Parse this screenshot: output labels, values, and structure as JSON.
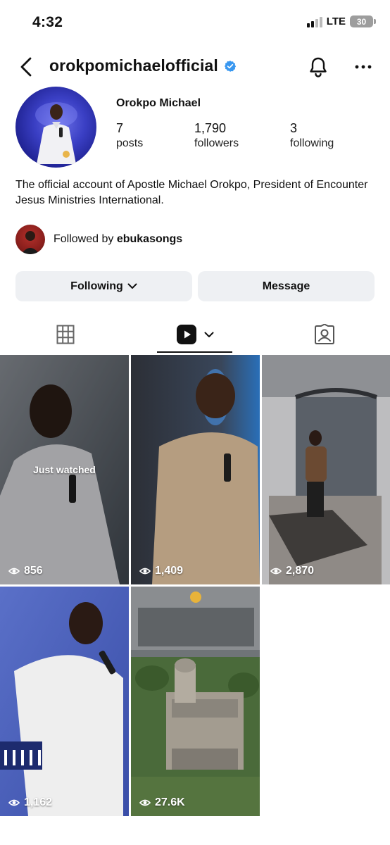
{
  "status_bar": {
    "time": "4:32",
    "network": "LTE",
    "battery": "30"
  },
  "header": {
    "username": "orokpomichaelofficial",
    "verified": true,
    "back_icon": "chevron-left-icon",
    "bell_icon": "bell-icon",
    "more_icon": "more-horizontal-icon"
  },
  "profile": {
    "display_name": "Orokpo Michael",
    "stats": [
      {
        "value": "7",
        "label": "posts"
      },
      {
        "value": "1,790",
        "label": "followers"
      },
      {
        "value": "3",
        "label": "following"
      }
    ],
    "bio": "The official account of Apostle Michael Orokpo, President of Encounter Jesus Ministries International.",
    "followed_by_prefix": "Followed by ",
    "followed_by_user": "ebukasongs"
  },
  "actions": {
    "following_label": "Following",
    "message_label": "Message"
  },
  "tabs": [
    {
      "icon": "grid-icon",
      "active": false
    },
    {
      "icon": "reels-icon",
      "active": true
    },
    {
      "icon": "tagged-icon",
      "active": false
    }
  ],
  "reels": [
    {
      "views": "856",
      "badge": "Just watched"
    },
    {
      "views": "1,409"
    },
    {
      "views": "2,870"
    },
    {
      "views": "1,162"
    },
    {
      "views": "27.6K"
    }
  ],
  "colors": {
    "verified_blue": "#3897f0",
    "button_bg": "#eef0f3"
  }
}
